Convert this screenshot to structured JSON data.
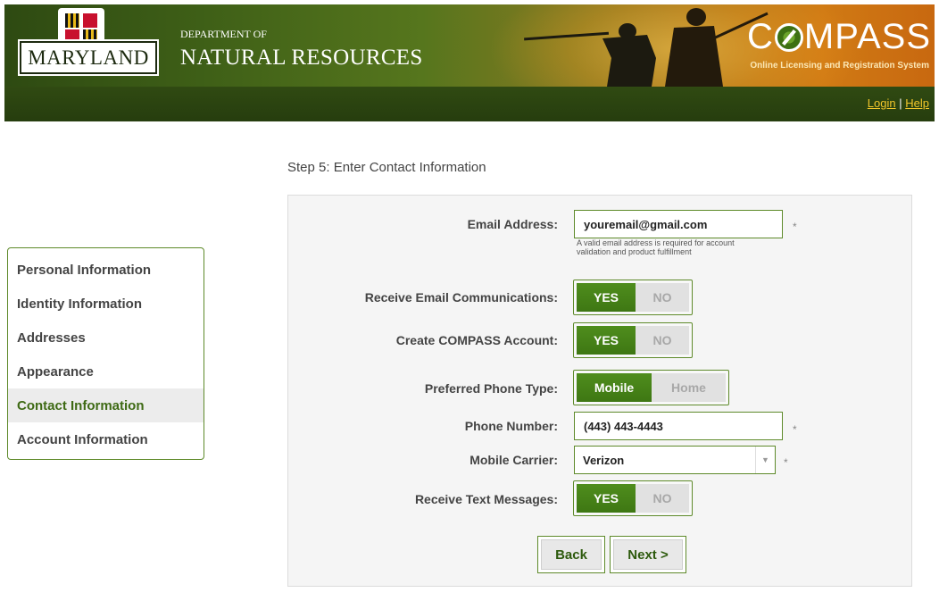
{
  "header": {
    "logo_text": "MARYLAND",
    "dept_line1": "DEPARTMENT OF",
    "dept_line2": "NATURAL RESOURCES",
    "app_name_prefix": "C",
    "app_name_suffix": "MPASS",
    "app_subtitle": "Online Licensing and Registration System"
  },
  "nav": {
    "login": "Login",
    "separator": "|",
    "help": "Help"
  },
  "step_title": "Step 5: Enter Contact Information",
  "sidebar": {
    "items": [
      {
        "label": "Personal Information",
        "active": false
      },
      {
        "label": "Identity Information",
        "active": false
      },
      {
        "label": "Addresses",
        "active": false
      },
      {
        "label": "Appearance",
        "active": false
      },
      {
        "label": "Contact Information",
        "active": true
      },
      {
        "label": "Account Information",
        "active": false
      }
    ]
  },
  "form": {
    "email": {
      "label": "Email Address:",
      "value": "youremail@gmail.com",
      "hint": "A valid email address is required for account validation and product fulfillment",
      "required": "*"
    },
    "receive_email": {
      "label": "Receive Email Communications:",
      "on": "YES",
      "off": "NO"
    },
    "create_account": {
      "label": "Create COMPASS Account:",
      "on": "YES",
      "off": "NO"
    },
    "phone_type": {
      "label": "Preferred Phone Type:",
      "on": "Mobile",
      "off": "Home"
    },
    "phone_number": {
      "label": "Phone Number:",
      "value": "(443) 443-4443",
      "required": "*"
    },
    "mobile_carrier": {
      "label": "Mobile Carrier:",
      "value": "Verizon",
      "required": "*"
    },
    "receive_text": {
      "label": "Receive Text Messages:",
      "on": "YES",
      "off": "NO"
    },
    "buttons": {
      "back": "Back",
      "next": "Next >"
    }
  },
  "colors": {
    "accent_green": "#3e7713",
    "link_gold": "#f0c52a",
    "nav_dark": "#2b4410"
  }
}
